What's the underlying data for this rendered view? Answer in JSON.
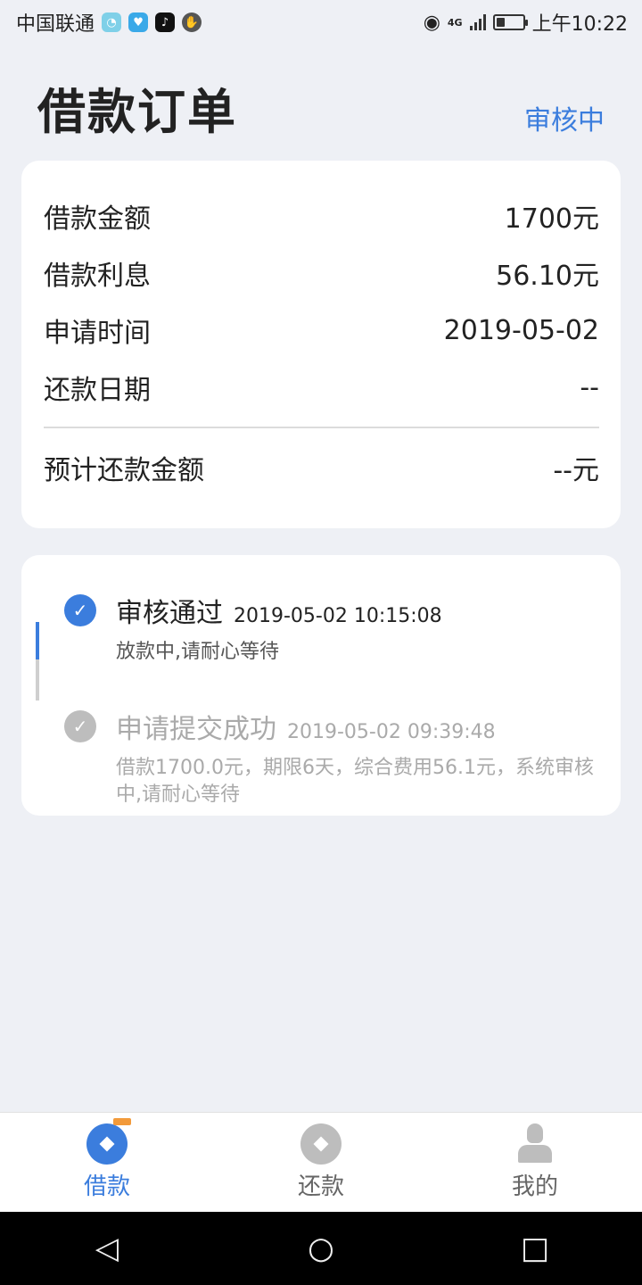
{
  "status_bar": {
    "carrier": "中国联通",
    "network": "4G",
    "time": "上午10:22",
    "battery_level": 0.35
  },
  "header": {
    "title": "借款订单",
    "status": "审核中"
  },
  "summary": {
    "rows": [
      {
        "label": "借款金额",
        "value": "1700元"
      },
      {
        "label": "借款利息",
        "value": "56.10元"
      },
      {
        "label": "申请时间",
        "value": "2019-05-02"
      },
      {
        "label": "还款日期",
        "value": "--"
      }
    ],
    "total": {
      "label": "预计还款金额",
      "value": "--元"
    }
  },
  "timeline": [
    {
      "title": "审核通过",
      "time": "2019-05-02 10:15:08",
      "desc": "放款中,请耐心等待",
      "state": "active"
    },
    {
      "title": "申请提交成功",
      "time": "2019-05-02 09:39:48",
      "desc": "借款1700.0元，期限6天，综合费用56.1元，系统审核中,请耐心等待",
      "state": "done"
    }
  ],
  "bottom_nav": [
    {
      "label": "借款",
      "icon": "loan-icon",
      "active": true
    },
    {
      "label": "还款",
      "icon": "repay-icon",
      "active": false
    },
    {
      "label": "我的",
      "icon": "profile-icon",
      "active": false
    }
  ],
  "colors": {
    "accent": "#3b7ddd",
    "inactive": "#bdbdbd",
    "background": "#eef0f5"
  }
}
